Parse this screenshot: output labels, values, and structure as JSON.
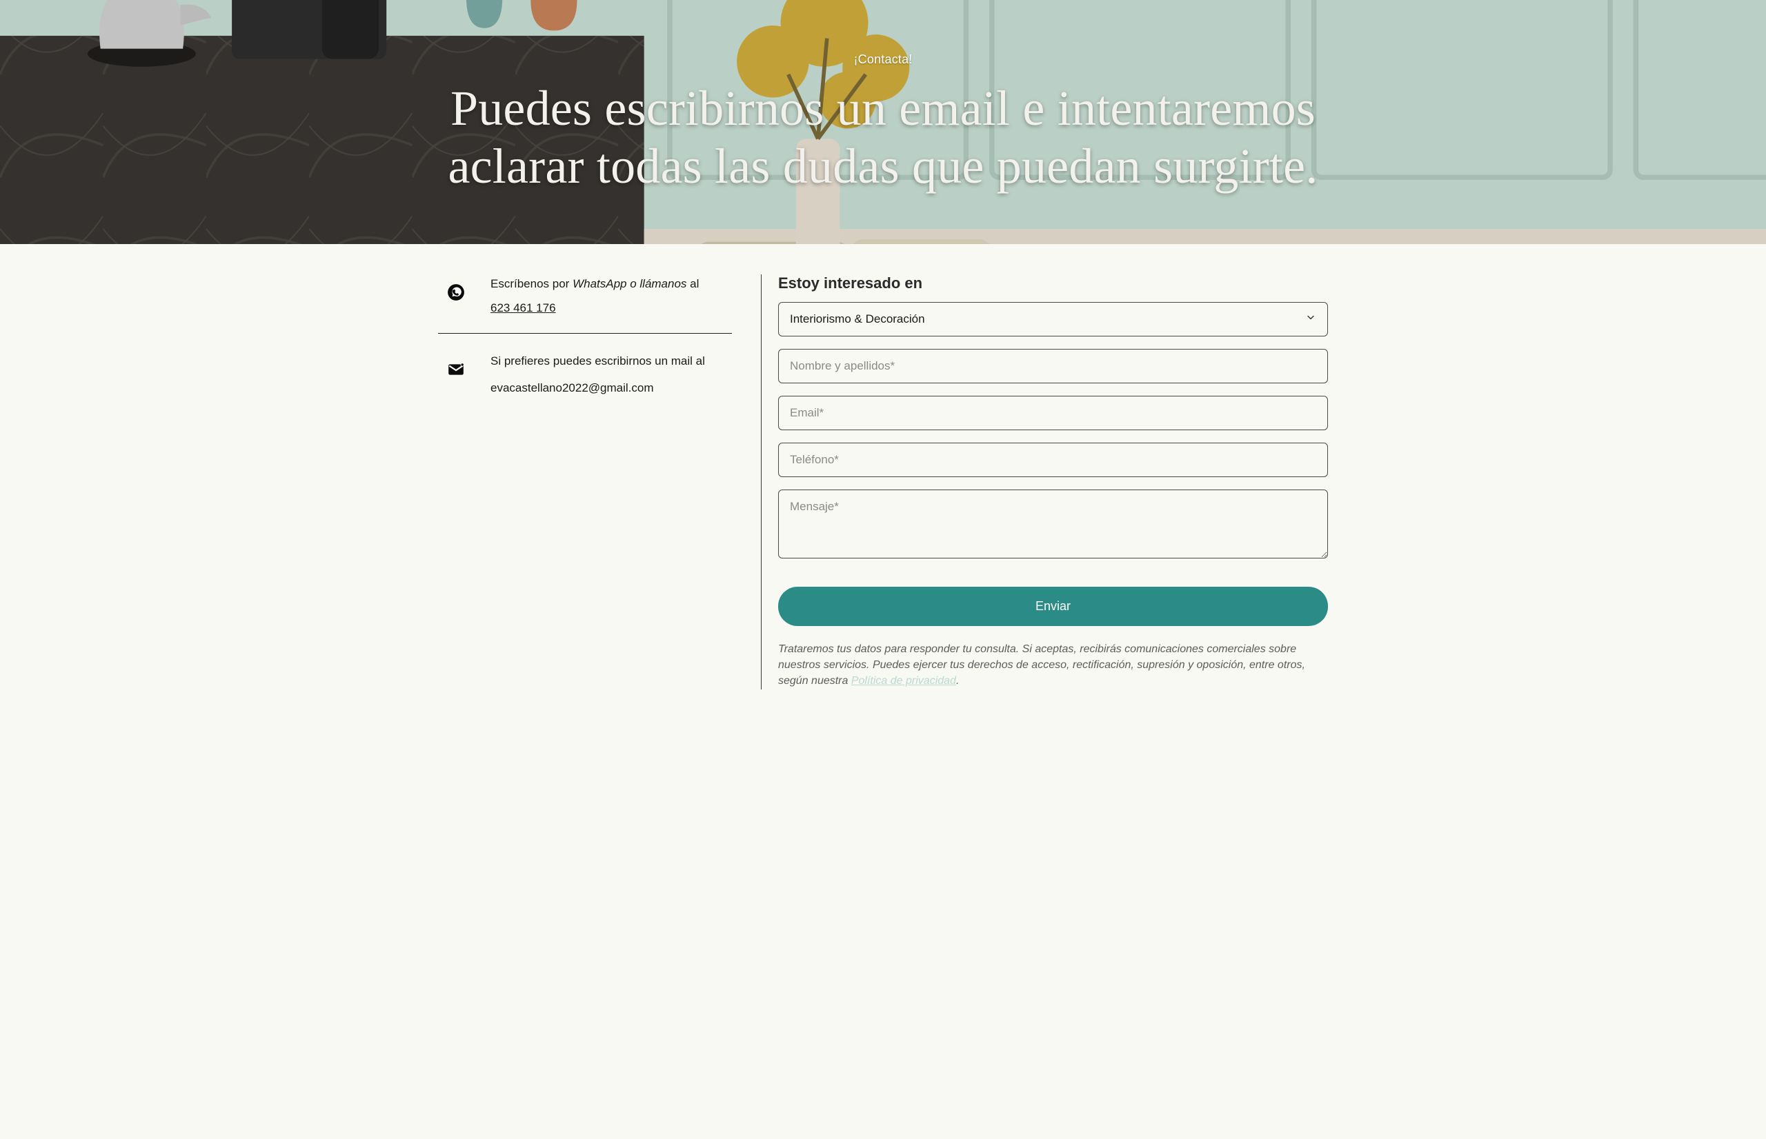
{
  "hero": {
    "eyebrow": "¡Contacta!",
    "headline": "Puedes escribirnos un email e intentaremos aclarar todas las dudas que puedan surgirte."
  },
  "contact": {
    "whatsapp": {
      "prefix": "Escríbenos por ",
      "channel_italic": "WhatsApp o llámanos",
      "suffix": " al",
      "phone": "623 461 176"
    },
    "email": {
      "prefix": "Si prefieres puedes escribirnos un mail al",
      "address": "evacastellano2022@gmail.com"
    }
  },
  "form": {
    "interest_label": "Estoy interesado en",
    "interest_selected": "Interiorismo & Decoración",
    "name_placeholder": "Nombre y apellidos*",
    "email_placeholder": "Email*",
    "phone_placeholder": "Teléfono*",
    "message_placeholder": "Mensaje*",
    "submit_label": "Enviar"
  },
  "disclaimer": {
    "text_before_link": "Trataremos tus datos para responder tu consulta. Si aceptas, recibirás comunicaciones comerciales sobre nuestros servicios. Puedes ejercer tus derechos de acceso, rectificación, supresión y oposición, entre otros, según nuestra ",
    "link_text": "Política de privacidad",
    "text_after_link": "."
  },
  "colors": {
    "accent": "#2a8b87"
  }
}
